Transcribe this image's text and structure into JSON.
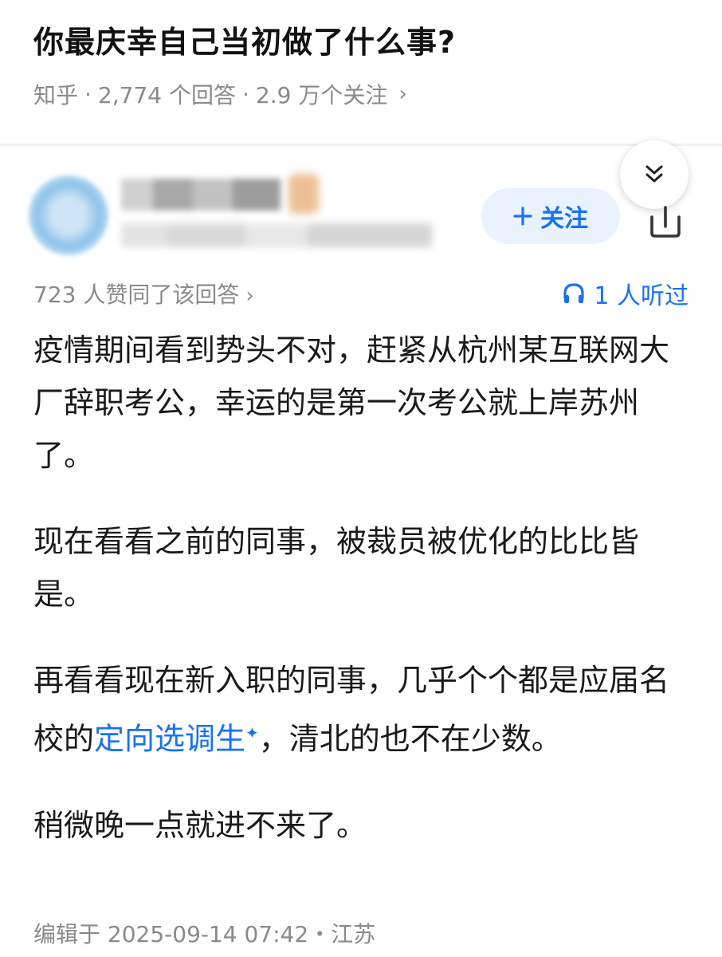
{
  "question": {
    "title": "你最庆幸自己当初做了什么事?",
    "source": "知乎",
    "answers_count": "2,774 个回答",
    "followers_count": "2.9 万个关注",
    "separator": "·",
    "chevron": "›"
  },
  "author": {
    "follow_label": "关注",
    "follow_icon": "plus-icon"
  },
  "answer": {
    "votes_text": "723 人赞同了该回答",
    "listened_text": "1 人听过",
    "paragraph1": "疫情期间看到势头不对，赶紧从杭州某互联网大厂辞职考公，幸运的是第一次考公就上岸苏州了。",
    "paragraph2": "现在看看之前的同事，被裁员被优化的比比皆是。",
    "paragraph3_before": "再看看现在新入职的同事，几乎个个都是应届名校的",
    "paragraph3_link": "定向选调生",
    "paragraph3_after": "，清北的也不在少数。",
    "paragraph4": "稍微晚一点就进不来了。",
    "edit_info": "编辑于 2025-09-14 07:42・江苏"
  },
  "colors": {
    "accent": "#1772f6",
    "muted": "#8a8a8a",
    "text": "#1a1a1a"
  }
}
